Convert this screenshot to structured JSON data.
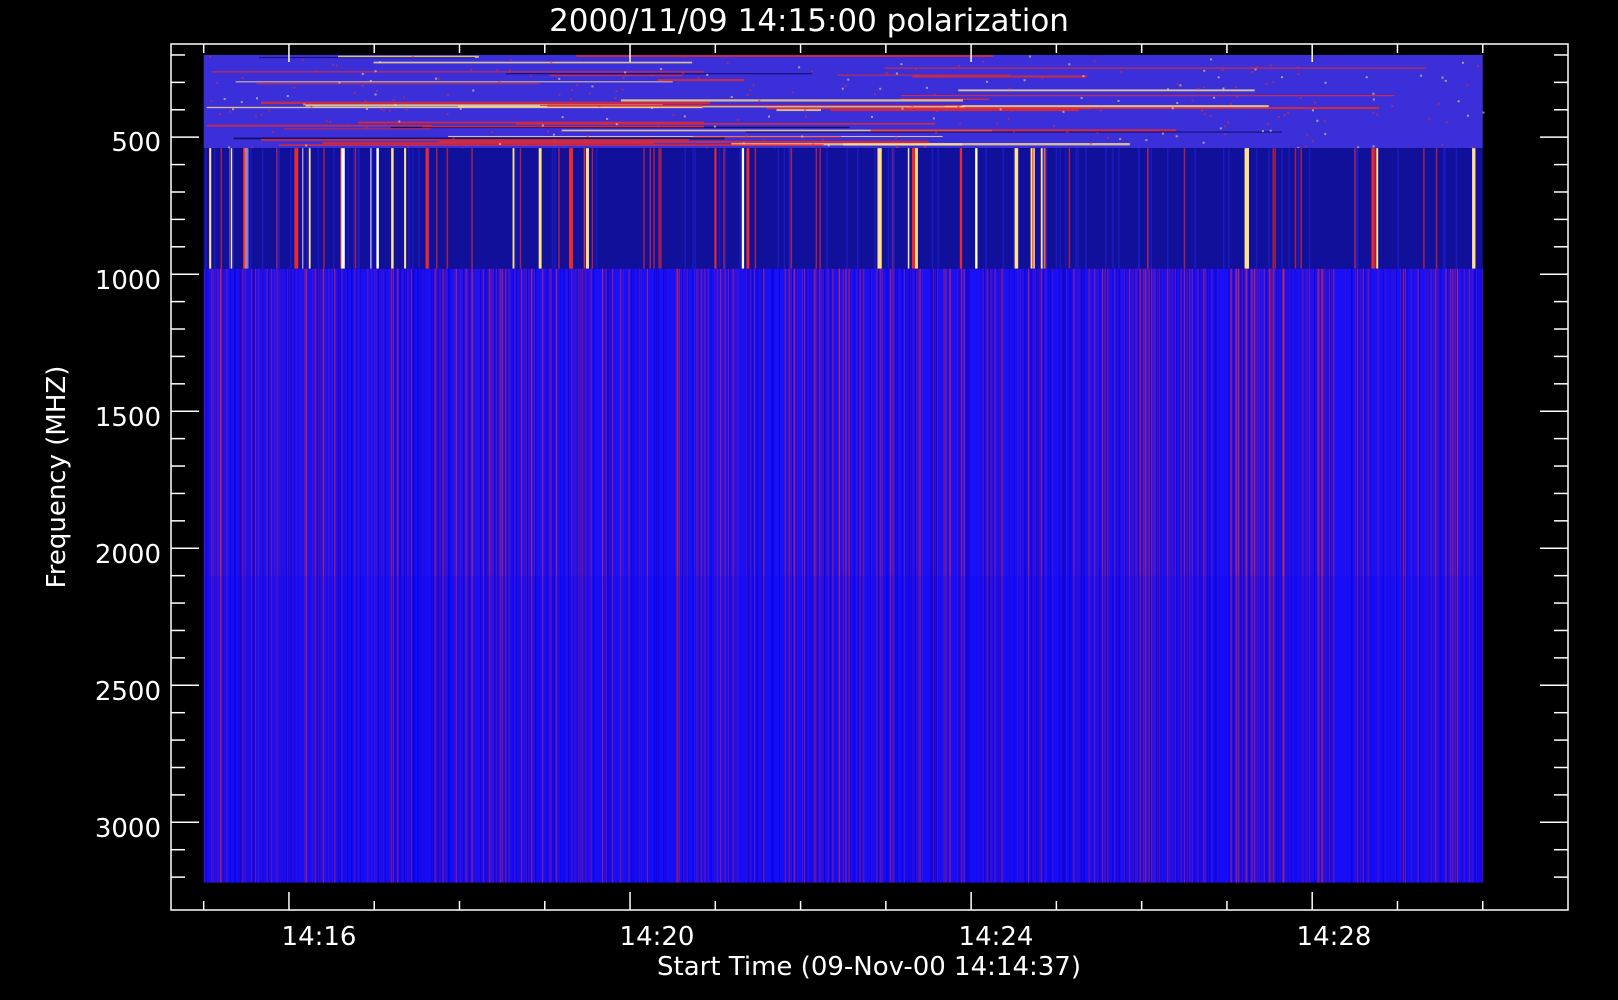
{
  "chart_data": {
    "type": "heatmap",
    "title": "2000/11/09 14:15:00 polarization",
    "xlabel": "Start Time (09-Nov-00 14:14:37)",
    "ylabel": "Frequency (MHZ)",
    "x_tick_labels": [
      "14:16",
      "14:20",
      "14:24",
      "14:28"
    ],
    "y_tick_labels": [
      "500",
      "1000",
      "1500",
      "2000",
      "2500",
      "3000"
    ],
    "y_axis_inverted": true,
    "xlim": [
      "14:14:37",
      "14:31:00"
    ],
    "ylim": [
      3320,
      160
    ],
    "data_extent": {
      "x": [
        "14:15:00",
        "14:30:00"
      ],
      "y": [
        200,
        3220
      ]
    },
    "frequency_bands_mhz": [
      {
        "range": [
          200,
          540
        ],
        "description": "noisy blue with red/yellow horizontal streaks"
      },
      {
        "range": [
          540,
          980
        ],
        "description": "dark blue with intense red/yellow/white vertical bursts"
      },
      {
        "range": [
          980,
          3220
        ],
        "description": "bright blue with fine red vertical striations"
      }
    ],
    "colors": {
      "background": "#000000",
      "foreground": "#ffffff",
      "band_top": "#3a2fd8",
      "band_mid": "#10109a",
      "band_low": "#1a10f5",
      "burst_red": "#e82a2a",
      "burst_yellow": "#ffe28a",
      "burst_white": "#ffffff"
    }
  }
}
